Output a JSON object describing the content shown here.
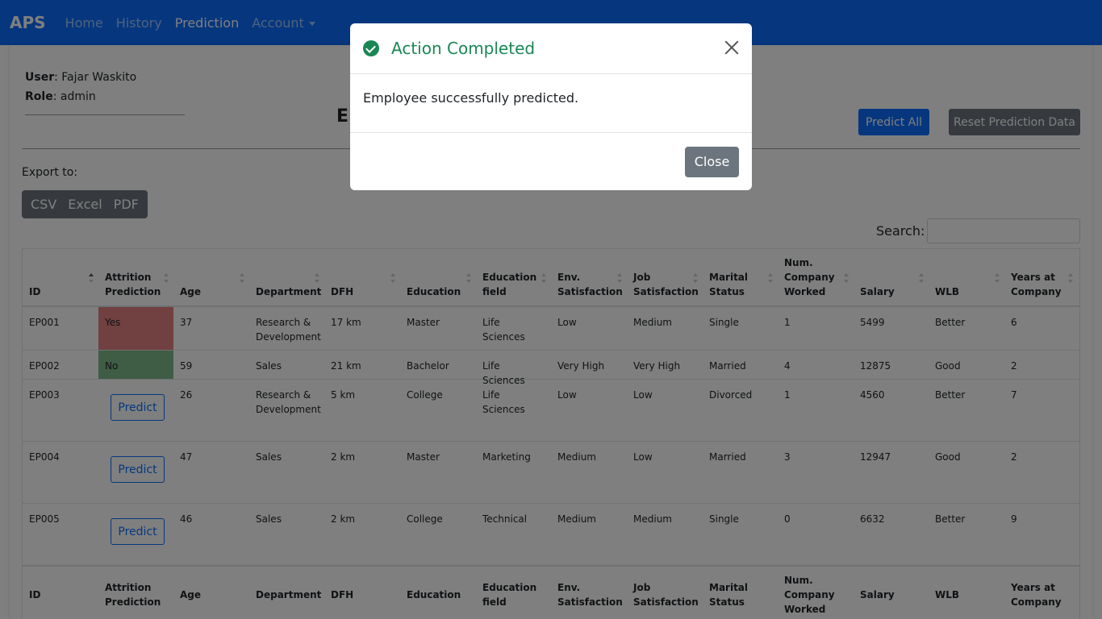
{
  "navbar": {
    "brand": "APS",
    "items": [
      "Home",
      "History",
      "Prediction",
      "Account"
    ]
  },
  "user": {
    "user_label": "User",
    "user_name": ": Fajar Waskito",
    "role_label": "Role",
    "role_value": ": admin"
  },
  "page": {
    "title_visible": "E"
  },
  "buttons": {
    "predict_all": "Predict All",
    "reset": "Reset Prediction Data"
  },
  "export": {
    "label": "Export to:",
    "options": [
      "CSV",
      "Excel",
      "PDF"
    ]
  },
  "search": {
    "label": "Search:",
    "value": ""
  },
  "table": {
    "columns": [
      "ID",
      "Attrition Prediction",
      "Age",
      "Department",
      "DFH",
      "Education",
      "Education field",
      "Env. Satisfaction",
      "Job Satisfaction",
      "Marital Status",
      "Num. Company Worked",
      "Salary",
      "WLB",
      "Years at Company"
    ],
    "rows": [
      {
        "id": "EP001",
        "prediction": "Yes",
        "age": "37",
        "department": "Research & Development",
        "dfh": "17 km",
        "education": "Master",
        "field": "Life Sciences",
        "env": "Low",
        "job": "Medium",
        "marital": "Single",
        "companies": "1",
        "salary": "5499",
        "wlb": "Better",
        "years": "6"
      },
      {
        "id": "EP002",
        "prediction": "No",
        "age": "59",
        "department": "Sales",
        "dfh": "21 km",
        "education": "Bachelor",
        "field": "Life Sciences",
        "env": "Very High",
        "job": "Very High",
        "marital": "Married",
        "companies": "4",
        "salary": "12875",
        "wlb": "Good",
        "years": "2"
      },
      {
        "id": "EP003",
        "prediction": "",
        "age": "26",
        "department": "Research & Development",
        "dfh": "5 km",
        "education": "College",
        "field": "Life Sciences",
        "env": "Low",
        "job": "Low",
        "marital": "Divorced",
        "companies": "1",
        "salary": "4560",
        "wlb": "Better",
        "years": "7"
      },
      {
        "id": "EP004",
        "prediction": "",
        "age": "47",
        "department": "Sales",
        "dfh": "2 km",
        "education": "Master",
        "field": "Marketing",
        "env": "Medium",
        "job": "Low",
        "marital": "Married",
        "companies": "3",
        "salary": "12947",
        "wlb": "Good",
        "years": "2"
      },
      {
        "id": "EP005",
        "prediction": "",
        "age": "46",
        "department": "Sales",
        "dfh": "2 km",
        "education": "College",
        "field": "Technical",
        "env": "Medium",
        "job": "Medium",
        "marital": "Single",
        "companies": "0",
        "salary": "6632",
        "wlb": "Better",
        "years": "9"
      }
    ],
    "predict_label": "Predict"
  },
  "modal": {
    "title": "Action Completed",
    "body": "Employee successfully predicted.",
    "close_label": "Close"
  },
  "colors": {
    "navbar": "#0d6efd",
    "success": "#198754",
    "yes_bg": "#e38080",
    "no_bg": "#7fb88a"
  }
}
